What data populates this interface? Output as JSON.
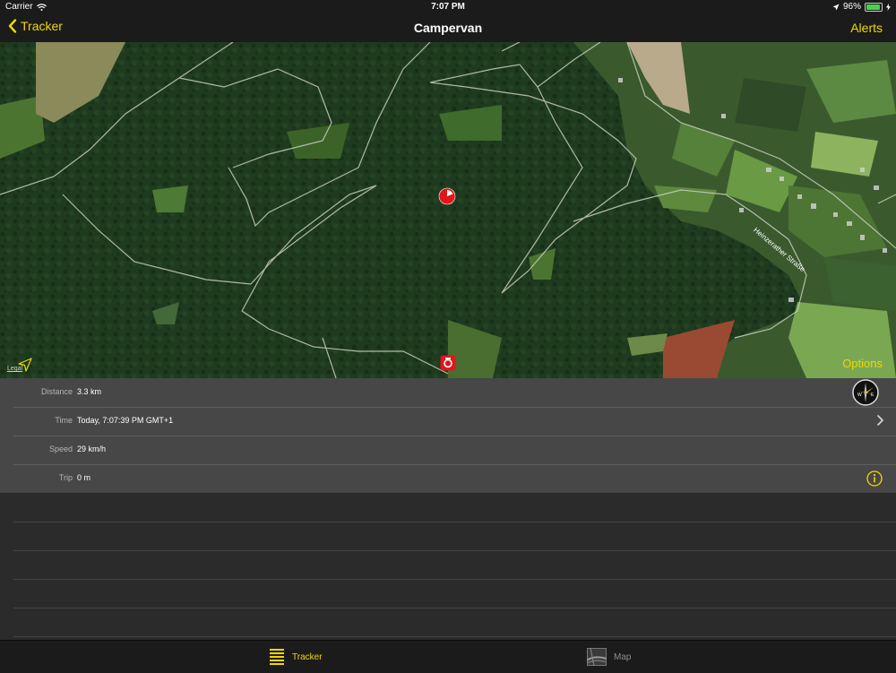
{
  "status": {
    "carrier": "Carrier",
    "time": "7:07 PM",
    "battery": "96%",
    "battery_level": 0.96
  },
  "nav": {
    "back_label": "Tracker",
    "title": "Campervan",
    "alerts_label": "Alerts"
  },
  "map": {
    "legal": "Legal",
    "options_label": "Options",
    "street": "Heinzerather Straße"
  },
  "details": {
    "rows": [
      {
        "label": "Distance",
        "value": "3.3 km"
      },
      {
        "label": "Time",
        "value": "Today, 7:07:39 PM GMT+1"
      },
      {
        "label": "Speed",
        "value": "29 km/h"
      },
      {
        "label": "Trip",
        "value": "0 m"
      }
    ]
  },
  "tabs": {
    "tracker": "Tracker",
    "map": "Map"
  },
  "icons": {
    "back": "chevron-left-icon",
    "location_arrow": "location-arrow-icon",
    "wifi": "wifi-icon",
    "compass": "compass-icon",
    "info": "info-icon",
    "chevron": "chevron-right-icon",
    "tracker_tab": "list-icon",
    "map_tab": "map-icon",
    "marker_top": "pie-marker-icon",
    "marker_bottom": "camera-marker-icon"
  },
  "colors": {
    "accent": "#f0d800",
    "marker": "#e0161c"
  }
}
